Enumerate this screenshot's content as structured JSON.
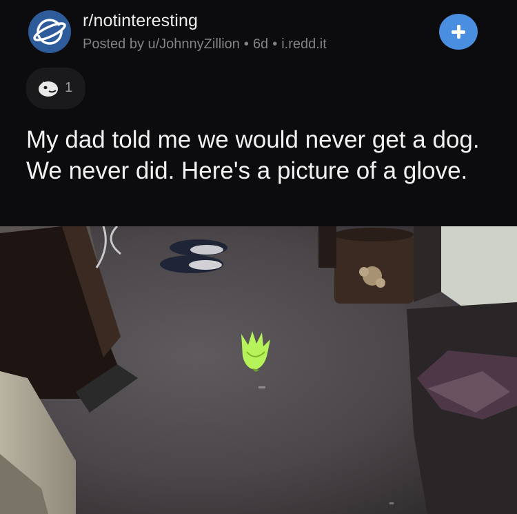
{
  "subreddit": {
    "name": "r/notinteresting",
    "icon": "planet-icon",
    "icon_color": "#2e5c9b"
  },
  "meta": {
    "posted_by": "Posted by u/JohnnyZillion",
    "age": "6d",
    "domain": "i.redd.it"
  },
  "join_button": {
    "icon": "plus-icon",
    "color": "#4a8ee0"
  },
  "award": {
    "icon": "award-icon",
    "count": "1"
  },
  "post": {
    "title": "My dad told me we would never get a dog. We never did. Here's a picture of a glove."
  },
  "photo": {
    "subject": "glove-on-carpet",
    "carpet_color": "#4b4649",
    "glove_color": "#b6f25a"
  }
}
